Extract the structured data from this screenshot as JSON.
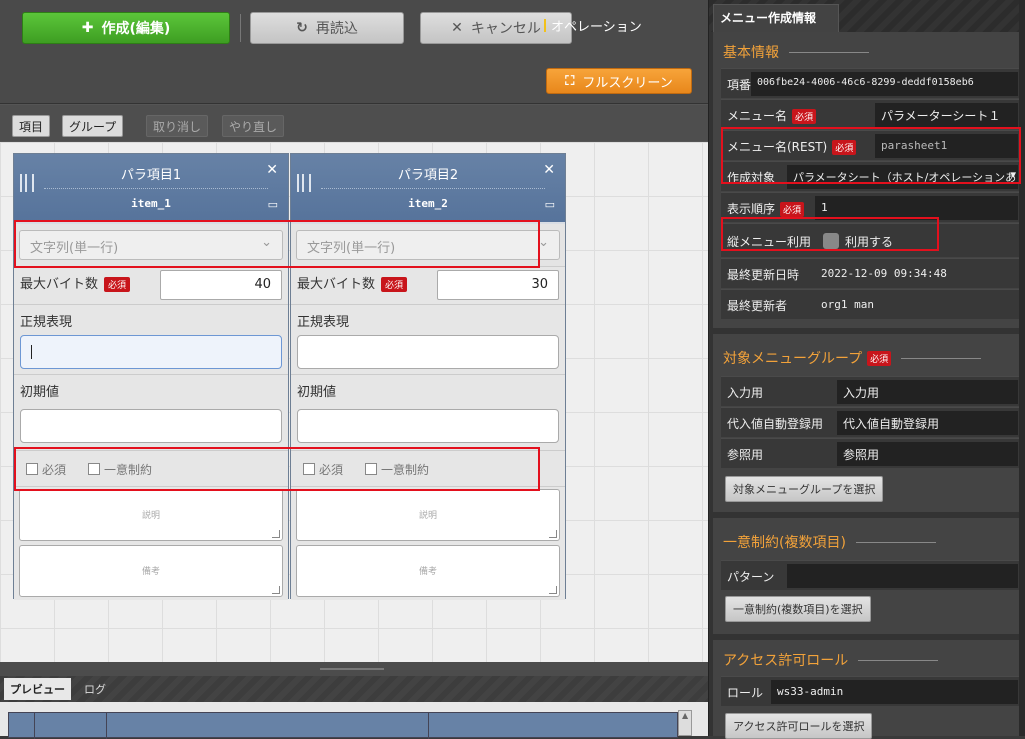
{
  "toolbar": {
    "create_label": "作成(編集)",
    "reload_label": "再読込",
    "cancel_label": "キャンセル",
    "fullscreen_label": "フルスクリーン"
  },
  "editbar": {
    "item_label": "項目",
    "group_label": "グループ",
    "undo_label": "取り消し",
    "redo_label": "やり直し"
  },
  "columns": [
    {
      "title": "パラ項目1",
      "name": "item_1",
      "type": "文字列(単一行)",
      "max_bytes_label": "最大バイト数",
      "max_bytes": "40",
      "regex_label": "正規表現",
      "default_label": "初期値",
      "required_label": "必須",
      "unique_label": "一意制約",
      "description_placeholder": "説明",
      "remarks_placeholder": "備考"
    },
    {
      "title": "パラ項目2",
      "name": "item_2",
      "type": "文字列(単一行)",
      "max_bytes_label": "最大バイト数",
      "max_bytes": "30",
      "regex_label": "正規表現",
      "default_label": "初期値",
      "required_label": "必須",
      "unique_label": "一意制約",
      "description_placeholder": "説明",
      "remarks_placeholder": "備考"
    }
  ],
  "required_badge": "必須",
  "preview": {
    "tabs": [
      "プレビュー",
      "ログ"
    ],
    "header_text": "オペレーション"
  },
  "panel": {
    "tab_label": "メニュー作成情報",
    "basic": {
      "title": "基本情報",
      "id_label": "項番",
      "id_value": "006fbe24-4006-46c6-8299-deddf0158eb6",
      "menu_name_label": "メニュー名",
      "menu_name_value": "パラメーターシート１",
      "menu_name_rest_label": "メニュー名(REST)",
      "menu_name_rest_value": "parasheet1",
      "target_label": "作成対象",
      "target_value": "パラメータシート（ホスト/オペレーションあり）",
      "order_label": "表示順序",
      "order_value": "1",
      "vertical_label": "縦メニュー利用",
      "vertical_value": "利用する",
      "updated_label": "最終更新日時",
      "updated_value": "2022-12-09 09:34:48",
      "updater_label": "最終更新者",
      "updater_value": "org1 man"
    },
    "target_group": {
      "title": "対象メニューグループ",
      "input_label": "入力用",
      "input_value": "入力用",
      "auto_label": "代入値自動登録用",
      "auto_value": "代入値自動登録用",
      "ref_label": "参照用",
      "ref_value": "参照用",
      "select_button": "対象メニューグループを選択"
    },
    "unique": {
      "title": "一意制約(複数項目)",
      "pattern_label": "パターン",
      "pattern_value": "",
      "select_button": "一意制約(複数項目)を選択"
    },
    "access": {
      "title": "アクセス許可ロール",
      "role_label": "ロール",
      "role_value": "ws33-admin",
      "select_button": "アクセス許可ロールを選択"
    }
  },
  "colors": {
    "create_green": "#4cb52e",
    "fullscreen_orange": "#f0962a",
    "column_header_blue": "#6782a6",
    "required_red": "#c8151b",
    "section_orange": "#f2a23a",
    "highlight_red": "#e3101d"
  },
  "icons": [
    "plus-icon",
    "reload-icon",
    "cancel-icon",
    "fullscreen-icon",
    "close-icon",
    "edit-icon",
    "chevron-down-icon",
    "grip-icon"
  ]
}
